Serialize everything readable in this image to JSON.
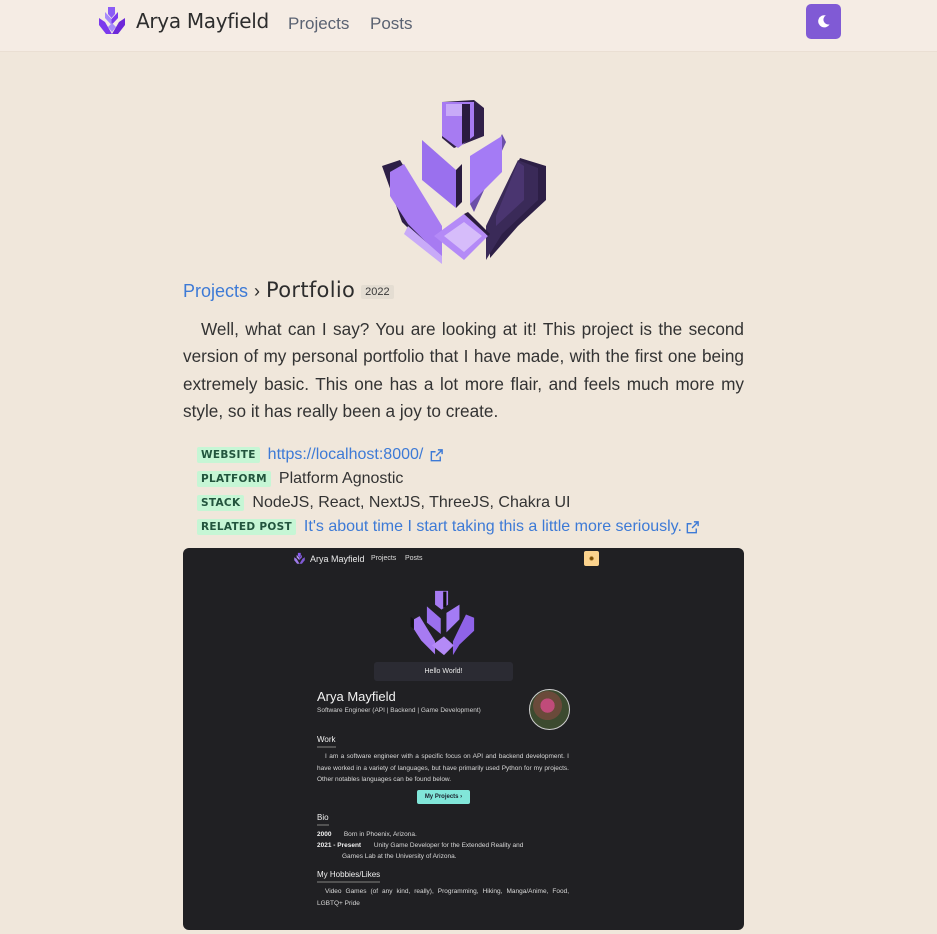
{
  "nav": {
    "brand_name": "Arya Mayfield",
    "links": [
      "Projects",
      "Posts"
    ],
    "theme_toggle_icon": "moon-icon",
    "accent": "#805ad5"
  },
  "breadcrumb": {
    "parent": "Projects",
    "separator": "›",
    "title": "Portfolio",
    "year": "2022"
  },
  "description": "Well, what can I say? You are looking at it! This project is the second version of my personal portfolio that I have made, with the first one being extremely basic. This one has a lot more flair, and feels much more my style, so it has really been a joy to create.",
  "meta": {
    "website": {
      "tag": "WEBSITE",
      "value": "https://localhost:8000/"
    },
    "platform": {
      "tag": "PLATFORM",
      "value": "Platform Agnostic"
    },
    "stack": {
      "tag": "STACK",
      "value": "NodeJS, React, NextJS, ThreeJS, Chakra UI"
    },
    "related": {
      "tag": "RELATED POST",
      "value": "It's about time I start taking this a little more seriously."
    }
  },
  "screenshot": {
    "brand_name": "Arya Mayfield",
    "links": [
      "Projects",
      "Posts"
    ],
    "theme_icon": "sun-icon",
    "hello": "Hello World!",
    "name": "Arya Mayfield",
    "subtitle": "Software Engineer (API | Backend | Game Development)",
    "work_heading": "Work",
    "work_text": "I am a software engineer with a specific focus on API and backend development. I have worked in a variety of languages, but have primarily used Python for my projects. Other notables languages can be found below.",
    "button": "My Projects  ›",
    "bio_heading": "Bio",
    "bio": [
      {
        "year": "2000",
        "text": "Born in Phoenix, Arizona."
      },
      {
        "year": "2021 - Present",
        "text": "Unity Game Developer for the Extended Reality and",
        "text2": "Games Lab at the University of Arizona."
      }
    ],
    "hobbies_heading": "My Hobbies/Likes",
    "hobbies_text": "Video Games (of any kind, really), Programming, Hiking, Manga/Anime, Food, LGBTQ+ Pride"
  }
}
